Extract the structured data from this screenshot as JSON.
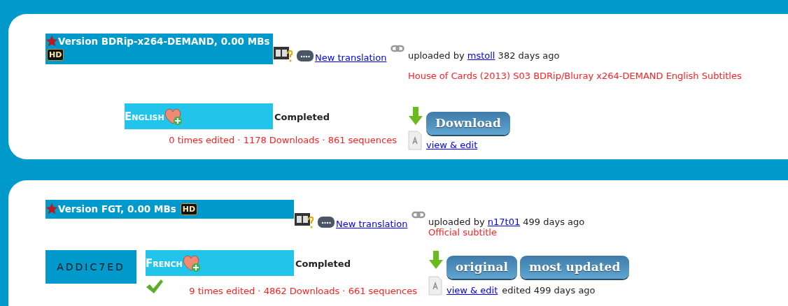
{
  "entries": [
    {
      "starred": true,
      "version": "Version BDRip-x264-DEMAND, 0.00 MBs",
      "hd_badge": "HD",
      "translation_link": "New translation",
      "uploaded_prefix": "uploaded by",
      "uploader": "mstoll",
      "age": "382 days ago",
      "note": "House of Cards (2013) S03 BDRip/Bluray x264-DEMAND English Subtitles",
      "language": "English",
      "status": "Completed",
      "verified": false,
      "stats": "0 times edited · 1178 Downloads · 861 sequences",
      "buttons": [
        "Download"
      ],
      "view_edit": "view & edit"
    },
    {
      "starred": true,
      "version": "Version FGT, 0.00 MBs",
      "hd_badge": "HD",
      "translation_link": "New translation",
      "uploaded_prefix": "uploaded by",
      "uploader": "n17t01",
      "age": "499 days ago",
      "note": "Official subtitle",
      "logo": "ADDIC7ED",
      "language": "French",
      "status": "Completed",
      "verified": true,
      "stats": "9 times edited · 4862 Downloads · 661 sequences",
      "buttons": [
        "original",
        "most updated"
      ],
      "view_edit": "view & edit",
      "edited": "edited 499 days ago"
    }
  ]
}
